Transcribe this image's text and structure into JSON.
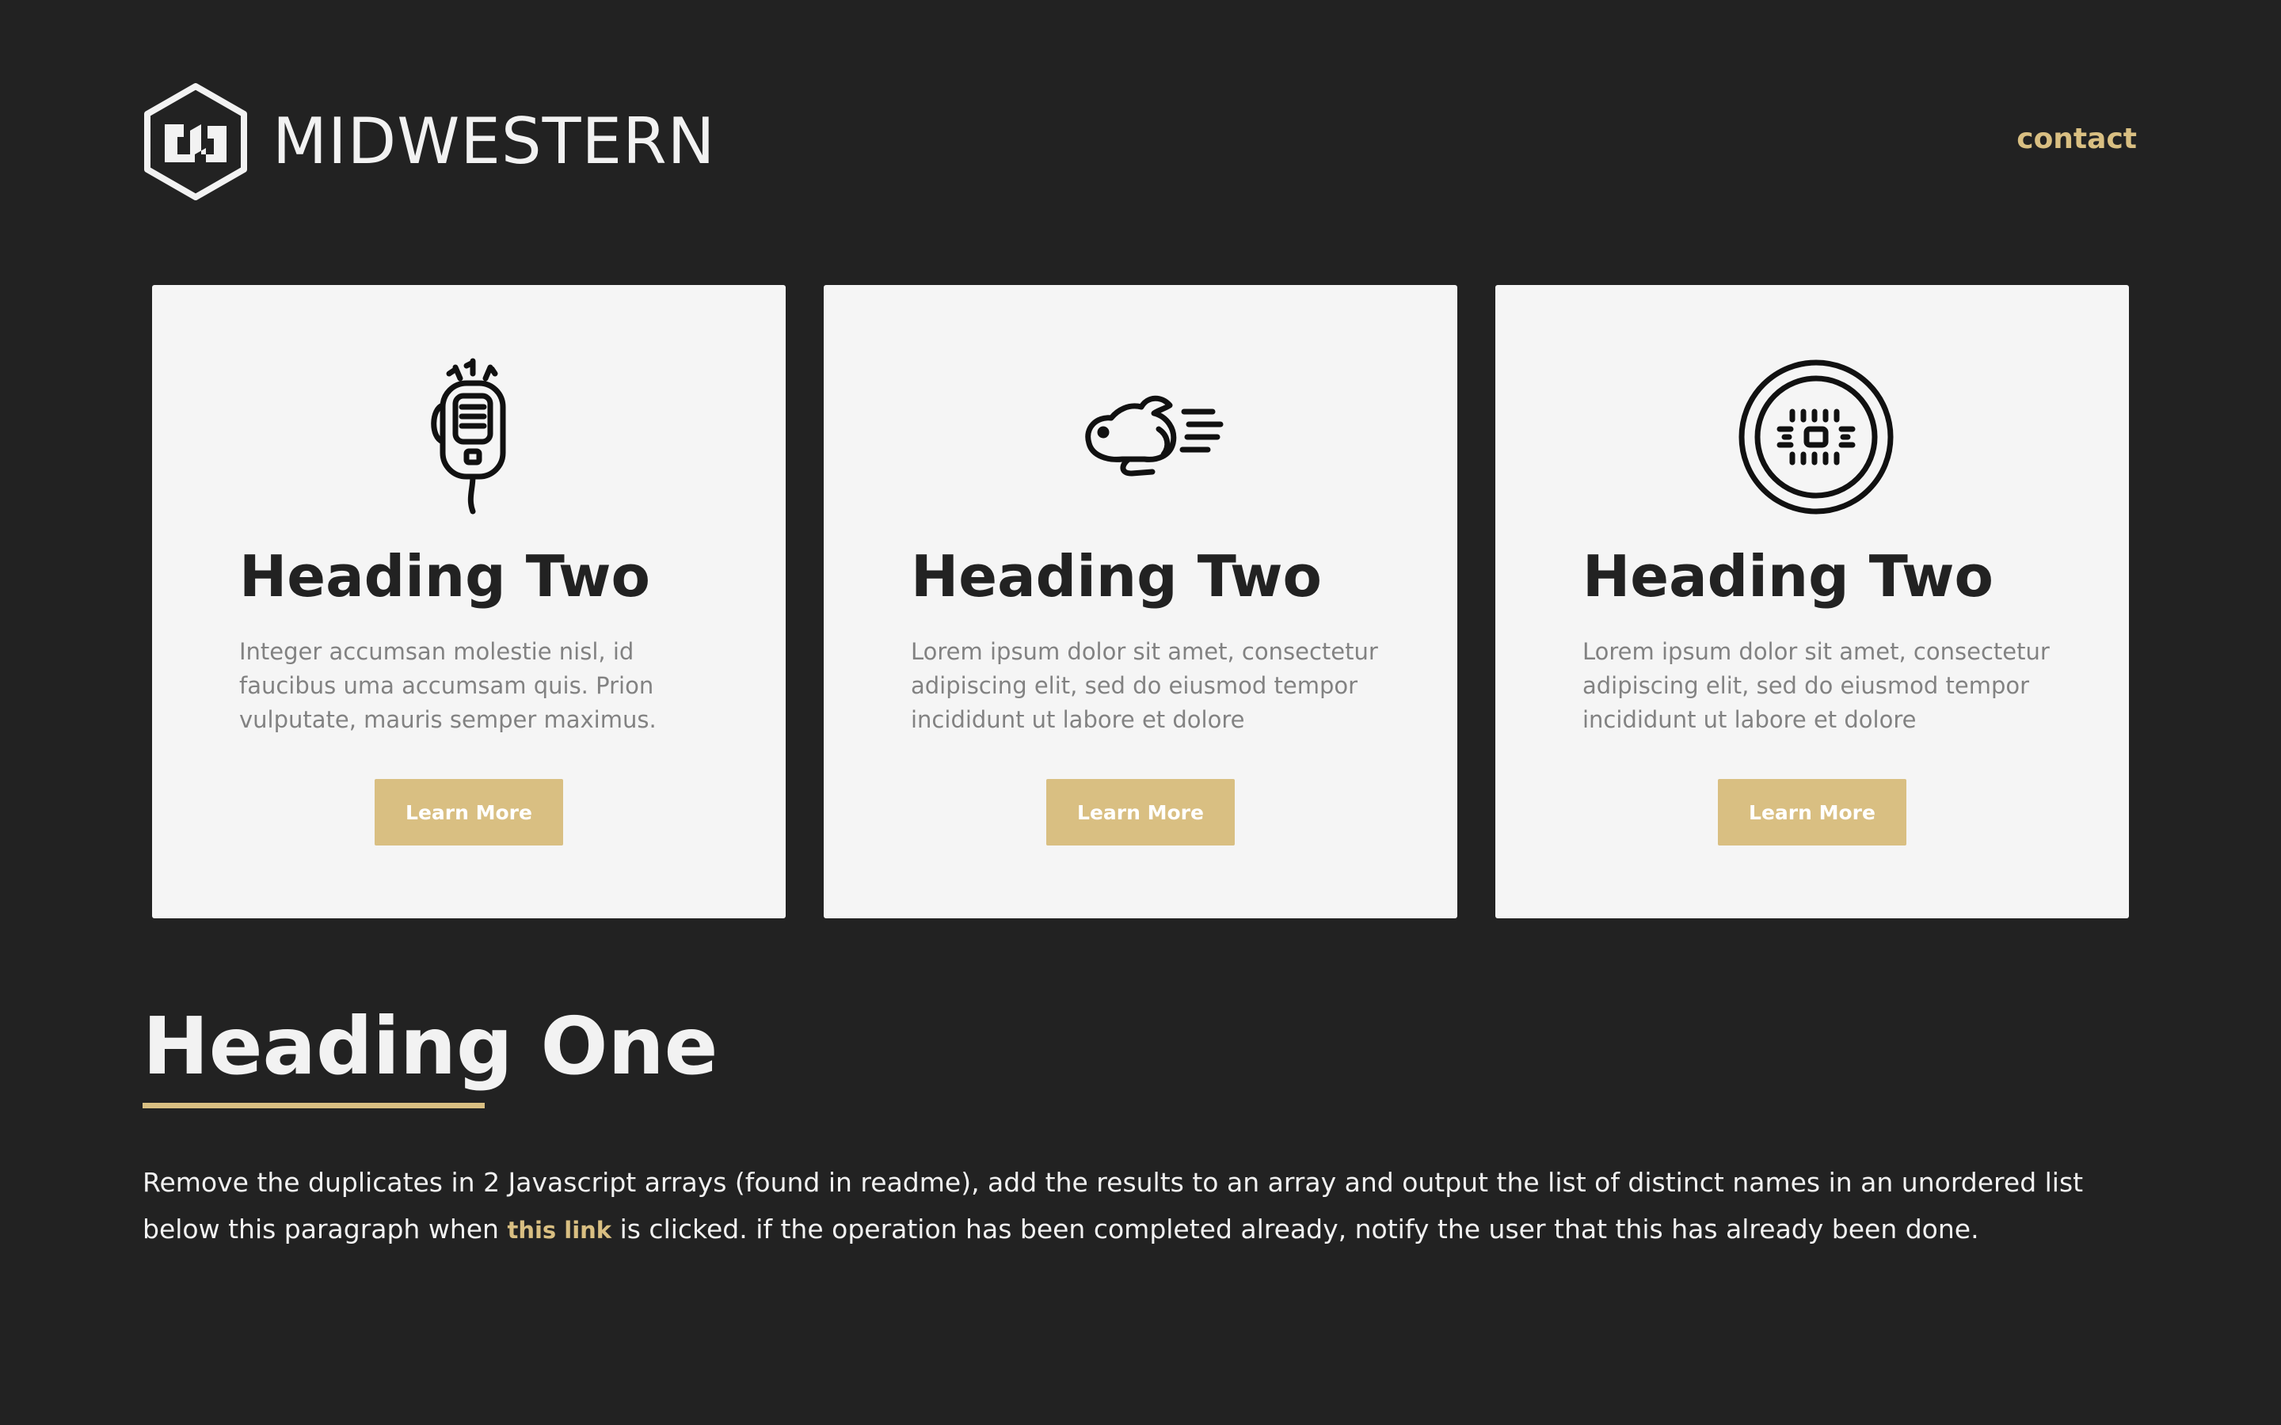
{
  "brand": {
    "name": "MIDWESTERN",
    "logo_icon": "midwestern-hexagon-logo-icon"
  },
  "nav": {
    "contact_label": "contact"
  },
  "colors": {
    "background": "#222222",
    "card_background": "#f5f5f5",
    "accent": "#d9bf82",
    "heading_dark": "#222222",
    "muted_text": "#828282",
    "light_text": "#f2f2f2"
  },
  "cards": [
    {
      "icon": "handheld-radio-microphone-icon",
      "heading": "Heading Two",
      "text": "Integer accumsan molestie nisl, id faucibus uma accumsam quis. Prion vulputate, mauris semper maximus.",
      "button_label": "Learn More"
    },
    {
      "icon": "running-rabbit-icon",
      "heading": "Heading Two",
      "text": "Lorem ipsum dolor sit amet, consectetur adipiscing elit, sed do eiusmod tempor incididunt ut labore et dolore",
      "button_label": "Learn More"
    },
    {
      "icon": "manhole-cover-icon",
      "heading": "Heading Two",
      "text": "Lorem ipsum dolor sit amet, consectetur adipiscing elit, sed do eiusmod tempor incididunt ut labore et dolore",
      "button_label": "Learn More"
    }
  ],
  "main": {
    "heading": "Heading One",
    "paragraph_before_link": "Remove the duplicates in 2 Javascript arrays (found in readme), add the results to an array and output the list of distinct names in an unordered list below this paragraph when ",
    "link_text": "this link",
    "paragraph_after_link": " is clicked. if the operation has been completed already, notify the user that this has already been done."
  }
}
